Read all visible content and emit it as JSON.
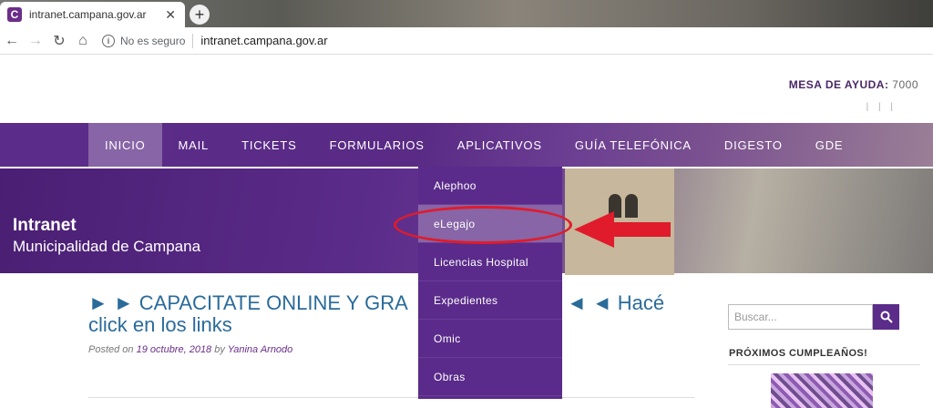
{
  "browser": {
    "tab_title": "intranet.campana.gov.ar",
    "tab_close": "✕",
    "new_tab": "+",
    "security": "No es seguro",
    "url": "intranet.campana.gov.ar",
    "favicon_letter": "C"
  },
  "header": {
    "help_label": "MESA DE AYUDA:",
    "help_number": "7000",
    "social": "| | |"
  },
  "nav": {
    "items": [
      {
        "label": "INICIO"
      },
      {
        "label": "MAIL"
      },
      {
        "label": "TICKETS"
      },
      {
        "label": "FORMULARIOS"
      },
      {
        "label": "APLICATIVOS"
      },
      {
        "label": "GUÍA TELEFÓNICA"
      },
      {
        "label": "DIGESTO"
      },
      {
        "label": "GDE"
      }
    ]
  },
  "banner": {
    "title": "Intranet",
    "subtitle": "Municipalidad de Campana"
  },
  "dropdown": {
    "items": [
      {
        "label": "Alephoo"
      },
      {
        "label": "eLegajo"
      },
      {
        "label": "Licencias Hospital"
      },
      {
        "label": "Expedientes"
      },
      {
        "label": "Omic"
      },
      {
        "label": "Obras"
      }
    ]
  },
  "post": {
    "title_part1": "► ► CAPACITATE ONLINE Y GRA",
    "title_part2": "◄ ◄ Hacé",
    "title_line2": "click en los links",
    "posted_on": "Posted on",
    "date": "19 octubre, 2018",
    "by": "by",
    "author": "Yanina Arnodo"
  },
  "sidebar": {
    "search_placeholder": "Buscar...",
    "birthdays_title": "PRÓXIMOS CUMPLEAÑOS!"
  },
  "colors": {
    "brand_purple": "#5b2c8a",
    "highlight_purple": "#8765a6",
    "annotation_red": "#e01b2b",
    "link_blue": "#2a6b9a"
  }
}
